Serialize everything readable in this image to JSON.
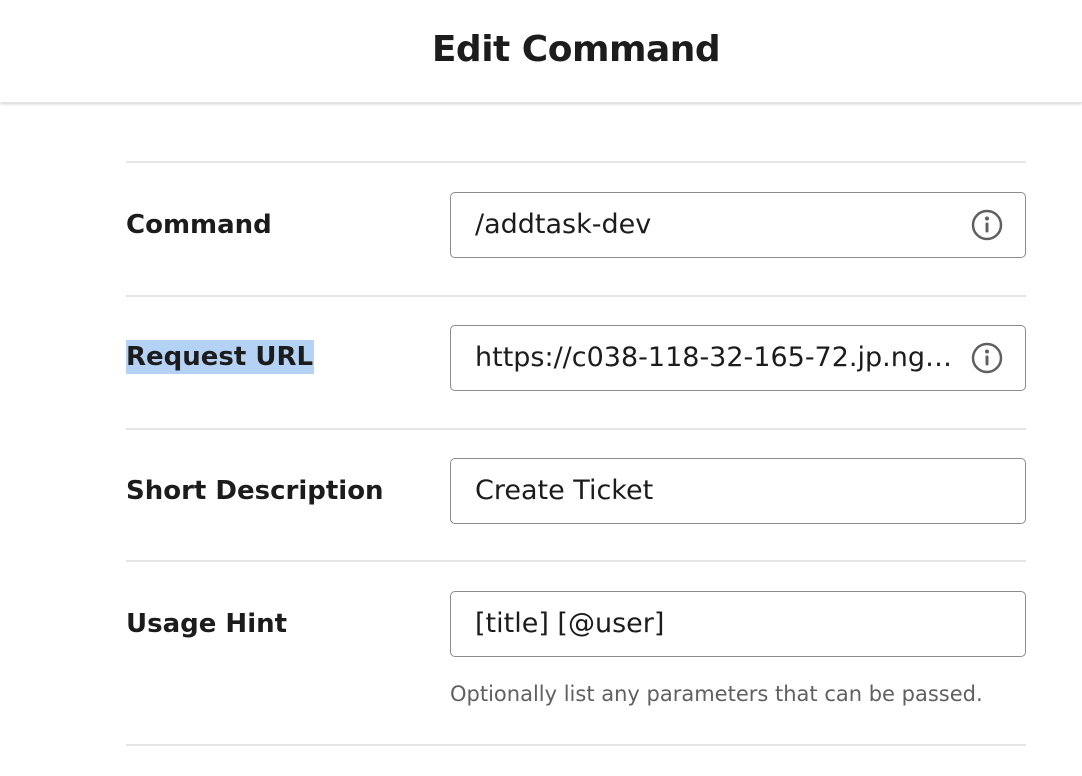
{
  "header": {
    "title": "Edit Command"
  },
  "fields": {
    "command": {
      "label": "Command",
      "value": "/addtask-dev",
      "icon": "info-icon"
    },
    "request_url": {
      "label": "Request URL",
      "value": "https://c038-118-32-165-72.jp.ngr…",
      "icon": "info-icon",
      "label_selected": true
    },
    "short_description": {
      "label": "Short Description",
      "value": "Create Ticket"
    },
    "usage_hint": {
      "label": "Usage Hint",
      "value": "[title] [@user]",
      "help_text": "Optionally list any parameters that can be passed."
    }
  },
  "colors": {
    "text": "#1d1c1d",
    "muted_text": "#616061",
    "border": "#8c8c8c",
    "divider": "#e6e6e6",
    "selection_highlight": "#b4d2f4"
  }
}
